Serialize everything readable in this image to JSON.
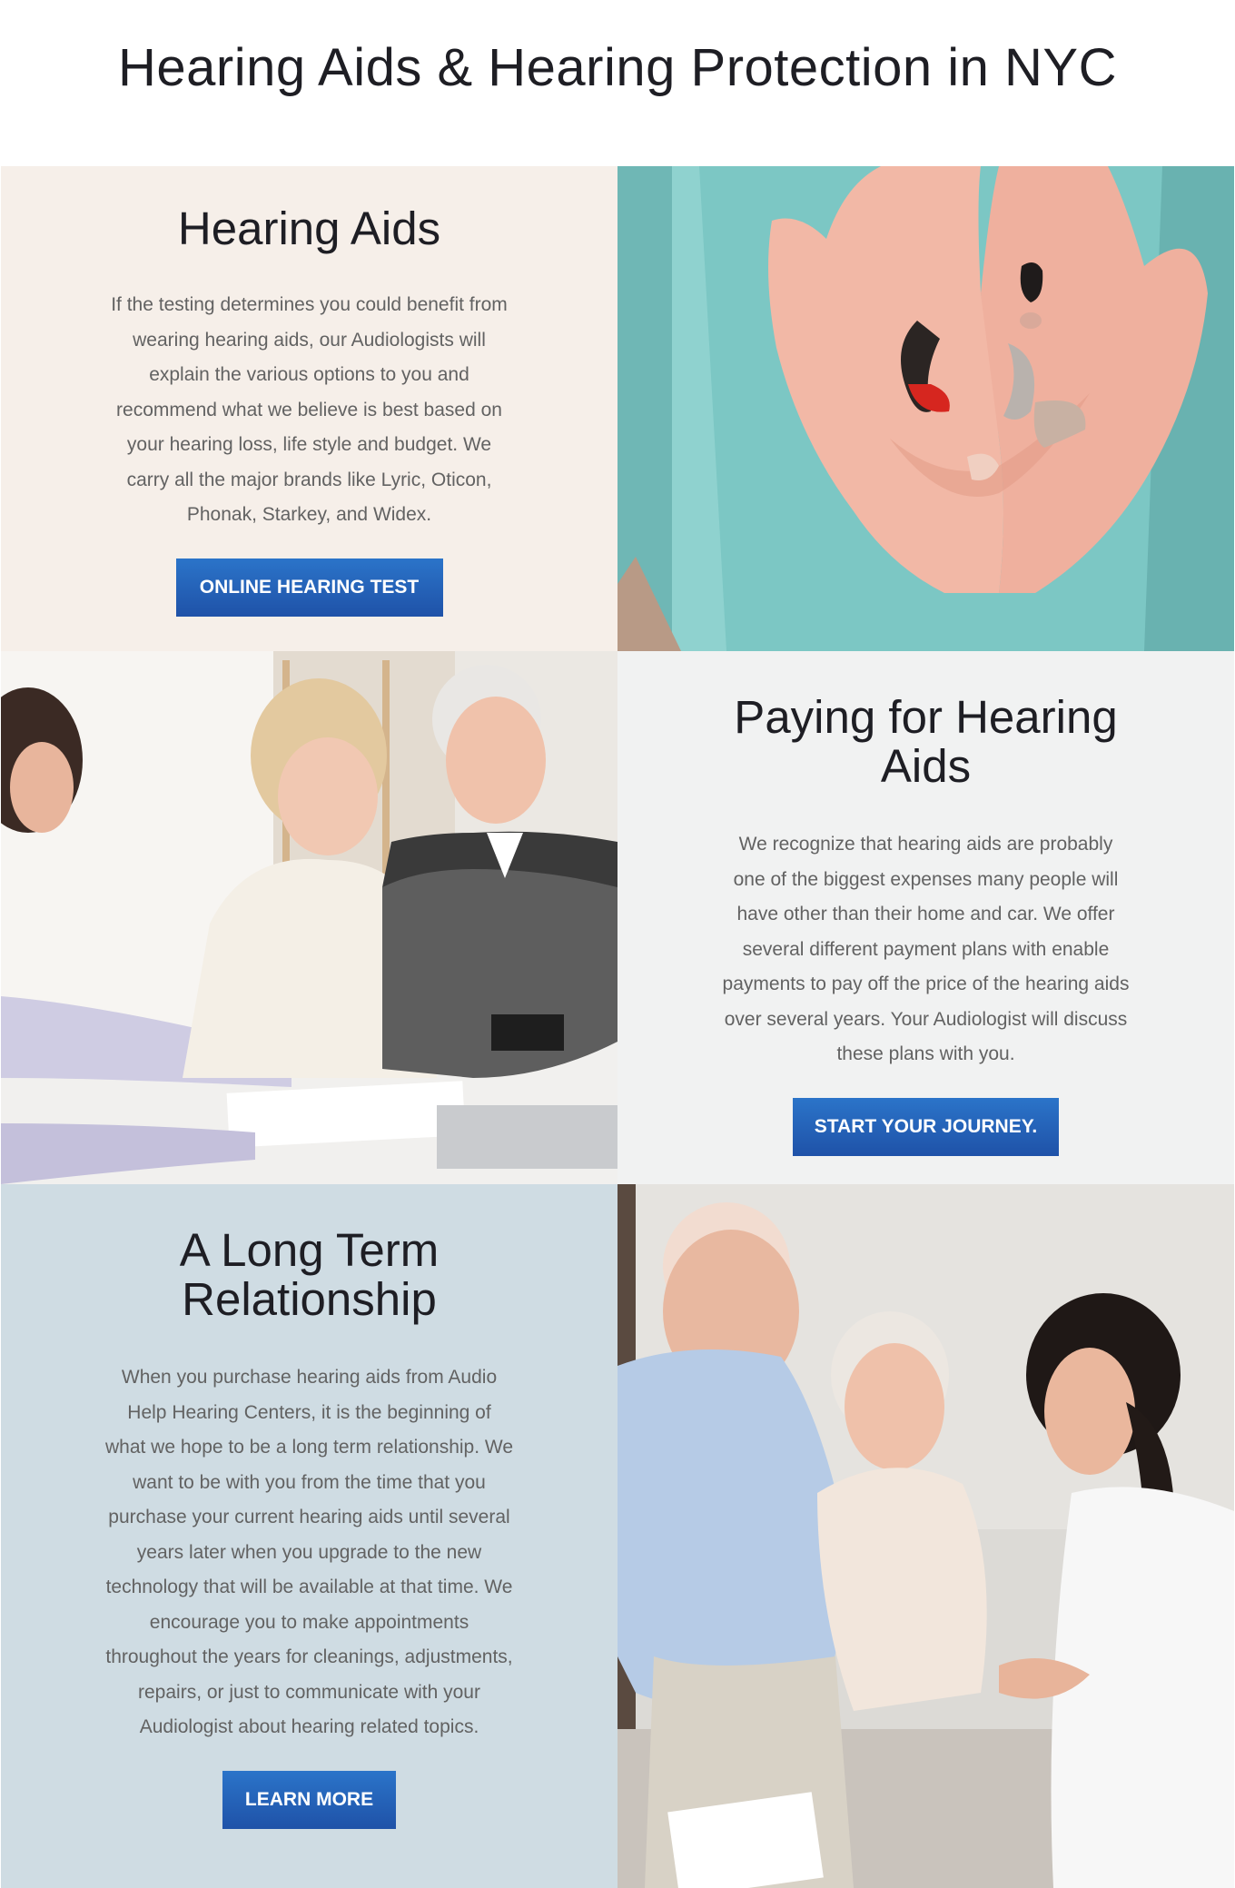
{
  "page": {
    "title": "Hearing Aids & Hearing Protection in NYC"
  },
  "sections": [
    {
      "heading": "Hearing Aids",
      "body": "If the testing determines you could benefit from wearing hearing aids, our Audiologists will explain the various options to you and recommend what we believe is best based on your hearing loss, life style and budget. We carry all the major brands like Lyric, Oticon, Phonak, Starkey, and Widex.",
      "button_label": "ONLINE HEARING TEST",
      "background": "#f6efe9"
    },
    {
      "heading": "Paying for Hearing Aids",
      "body": "We recognize that hearing aids are probably one of the biggest expenses many people will have other than their home and car. We offer several different payment plans with enable payments to pay off the price of the hearing aids over several years. Your Audiologist will discuss these plans with you.",
      "button_label": "START YOUR JOURNEY.",
      "background": "#f1f2f2"
    },
    {
      "heading": "A Long Term Relationship",
      "body": "When you purchase hearing aids from Audio Help Hearing Centers, it is the beginning of what we hope to be a long term relationship. We want to be with you from the time that you purchase your current hearing aids until several years later when you upgrade to the new technology that will be available at that time. We encourage you to make appointments throughout the years for cleanings, adjustments, repairs, or just to communicate with your Audiologist about hearing related topics.",
      "button_label": "LEARN MORE",
      "background": "#cfdce3"
    }
  ],
  "colors": {
    "button": "#2563b8",
    "heading": "#1e1e24",
    "body_text": "#626262"
  }
}
